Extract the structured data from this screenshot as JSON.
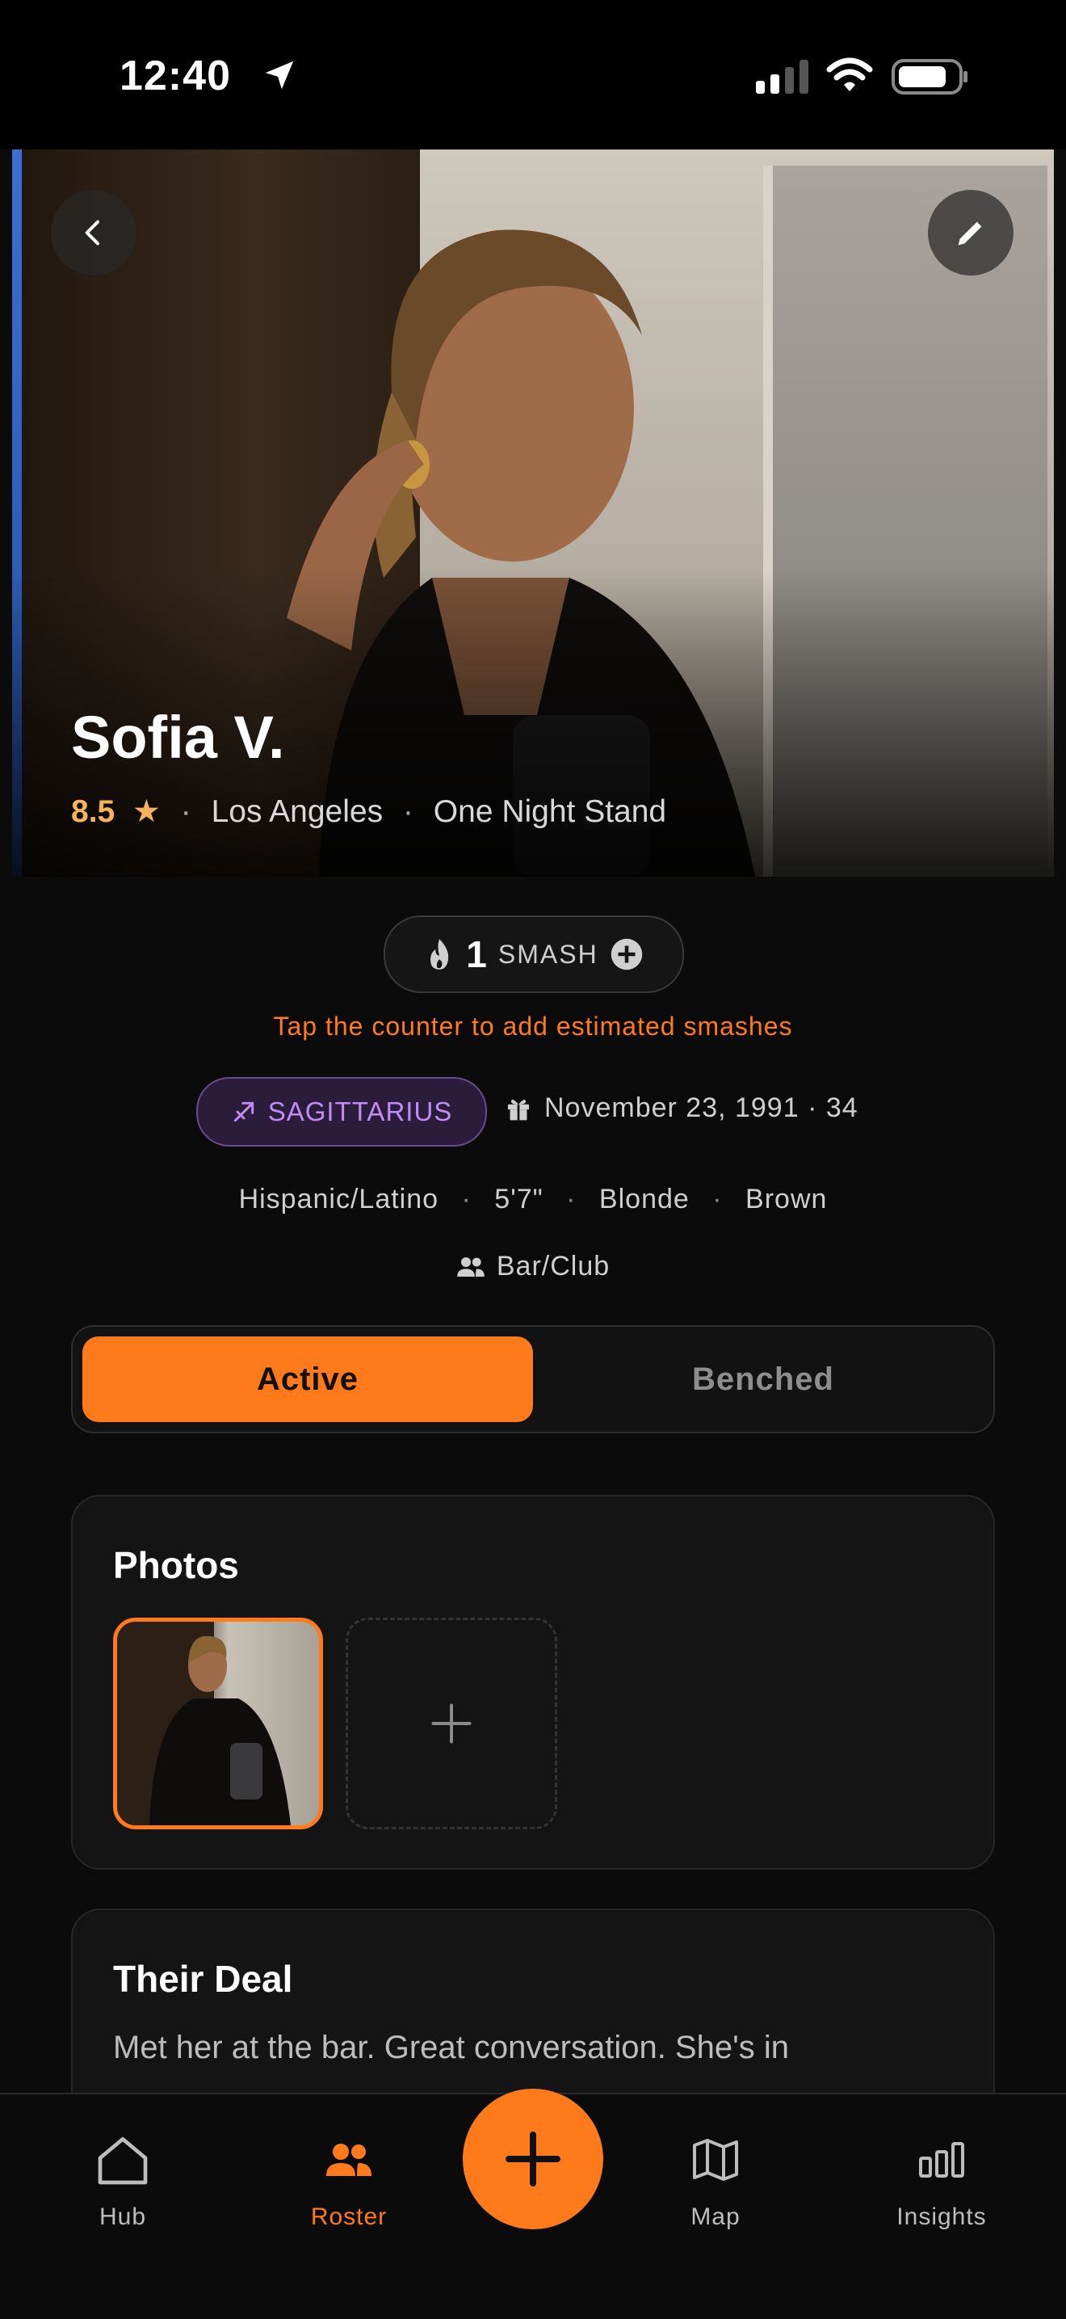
{
  "status_bar": {
    "time": "12:40"
  },
  "profile": {
    "name": "Sofia V.",
    "rating": "8.5",
    "location": "Los Angeles",
    "relationship": "One Night Stand"
  },
  "smash": {
    "count": "1",
    "label": "SMASH",
    "hint": "Tap the counter to add estimated smashes"
  },
  "zodiac": {
    "sign": "SAGITTARIUS"
  },
  "birthday": "November 23, 1991 · 34",
  "traits": [
    "Hispanic/Latino",
    "5'7\"",
    "Blonde",
    "Brown"
  ],
  "met_at": "Bar/Club",
  "status_toggle": {
    "active": "Active",
    "benched": "Benched",
    "selected": "Active"
  },
  "photos": {
    "title": "Photos"
  },
  "deal": {
    "title": "Their Deal",
    "text": "Met her at the bar. Great conversation. She's in"
  },
  "tabs": [
    {
      "label": "Hub",
      "icon": "home-icon"
    },
    {
      "label": "Roster",
      "icon": "people-icon"
    },
    {
      "label": "Map",
      "icon": "map-icon"
    },
    {
      "label": "Insights",
      "icon": "bar-chart-icon"
    }
  ],
  "colors": {
    "accent": "#ff7a1a",
    "zodiac": "#c08cf2",
    "rating": "#f6b35a"
  }
}
